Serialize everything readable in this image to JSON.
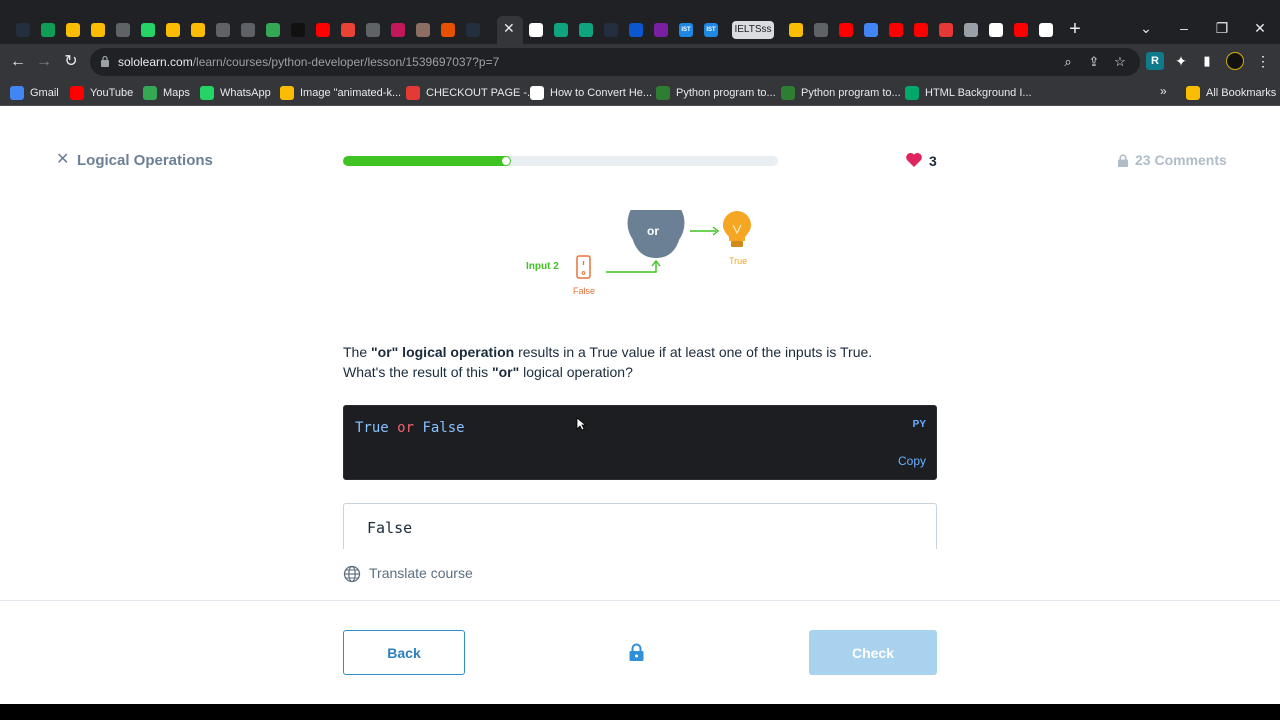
{
  "browser": {
    "tabs": [
      {
        "icon": "aws-icon",
        "color": "#232f3e"
      },
      {
        "icon": "sheets-icon",
        "color": "#0f9d58"
      },
      {
        "icon": "drive-icon",
        "color": "#fbbc04"
      },
      {
        "icon": "drive-icon",
        "color": "#fbbc04"
      },
      {
        "icon": "globe-icon",
        "color": "#5f6368"
      },
      {
        "icon": "whatsapp-icon",
        "color": "#25d366"
      },
      {
        "icon": "drive-icon",
        "color": "#fbbc04"
      },
      {
        "icon": "drive-icon",
        "color": "#fbbc04"
      },
      {
        "icon": "loading-icon",
        "color": "#5f6368"
      },
      {
        "icon": "loading-icon",
        "color": "#5f6368"
      },
      {
        "icon": "drive-icon",
        "color": "#34a853"
      },
      {
        "icon": "sololearn-icon",
        "color": "#111111"
      },
      {
        "icon": "youtube-icon",
        "color": "#ff0000"
      },
      {
        "icon": "gmail-icon",
        "color": "#ea4335"
      },
      {
        "icon": "globe-icon",
        "color": "#5f6368"
      },
      {
        "icon": "site-icon",
        "color": "#c2185b"
      },
      {
        "icon": "site-icon",
        "color": "#8d6e63"
      },
      {
        "icon": "site-icon",
        "color": "#e65100"
      },
      {
        "icon": "aws-icon",
        "color": "#232f3e"
      }
    ],
    "tabs_right": [
      {
        "icon": "site-icon",
        "color": "#ffffff"
      },
      {
        "icon": "chatgpt-icon",
        "color": "#10a37f"
      },
      {
        "icon": "chatgpt-icon",
        "color": "#10a37f"
      },
      {
        "icon": "aws-icon",
        "color": "#232f3e"
      },
      {
        "icon": "site-icon",
        "color": "#0b57d0"
      },
      {
        "icon": "site-icon",
        "color": "#7b1fa2"
      },
      {
        "icon": "ist-icon",
        "color": "#1e88e5",
        "text": "IST"
      },
      {
        "icon": "ist-icon",
        "color": "#1e88e5",
        "text": "IST"
      }
    ],
    "named_tab": "IELTSss",
    "tabs_far_right": [
      {
        "icon": "drive-icon",
        "color": "#fbbc04"
      },
      {
        "icon": "chatgpt-icon",
        "color": "#5f6368"
      },
      {
        "icon": "youtube-icon",
        "color": "#ff0000"
      },
      {
        "icon": "drive-icon",
        "color": "#4285f4"
      },
      {
        "icon": "youtube-icon",
        "color": "#ff0000"
      },
      {
        "icon": "youtube-icon",
        "color": "#ff0000"
      },
      {
        "icon": "site-icon",
        "color": "#e53935"
      },
      {
        "icon": "globe-icon",
        "color": "#9aa0a6"
      },
      {
        "icon": "site-icon",
        "color": "#ffffff"
      },
      {
        "icon": "youtube-icon",
        "color": "#ff0000"
      },
      {
        "icon": "google-icon",
        "color": "#ffffff"
      }
    ],
    "active_tab_close": "✕",
    "new_tab": "+",
    "url_host": "sololearn.com",
    "url_path": "/learn/courses/python-developer/lesson/1539697037?p=7",
    "bookmarks": [
      {
        "label": "Gmail",
        "color": "#4285f4"
      },
      {
        "label": "YouTube",
        "color": "#ff0000"
      },
      {
        "label": "Maps",
        "color": "#34a853"
      },
      {
        "label": "WhatsApp",
        "color": "#25d366"
      },
      {
        "label": "Image \"animated-k...",
        "color": "#fbbc04"
      },
      {
        "label": "CHECKOUT PAGE -...",
        "color": "#e53935"
      },
      {
        "label": "How to Convert He...",
        "color": "#ffffff"
      },
      {
        "label": "Python program to...",
        "color": "#2e7d32"
      },
      {
        "label": "Python program to...",
        "color": "#2e7d32"
      },
      {
        "label": "HTML Background I...",
        "color": "#00a86b"
      }
    ],
    "bookmarks_more": "»",
    "all_bookmarks": "All Bookmarks"
  },
  "lesson": {
    "close": "✕",
    "title": "Logical Operations",
    "progress": 0.35,
    "hearts": "3",
    "comments": "23 Comments",
    "diagram": {
      "operator": "or",
      "input_label": "Input 2",
      "input_value": "False",
      "output_value": "True"
    },
    "question": {
      "p1": "The ",
      "b1": "\"or\" logical operation",
      "p2": " results in a True value if at least one of the inputs is True.",
      "p3": "What's the result of this ",
      "b2": "\"or\"",
      "p4": " logical operation?"
    },
    "code": {
      "t1": "True",
      "kw": "or",
      "t2": "False",
      "lang": "PY",
      "copy": "Copy"
    },
    "answer": "False",
    "translate": "Translate course",
    "back": "Back",
    "check": "Check"
  }
}
